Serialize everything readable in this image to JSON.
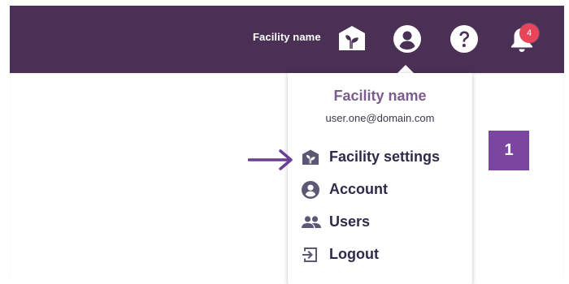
{
  "header": {
    "facility_name": "Facility name",
    "icons": [
      "facility-home-icon",
      "user-account-icon",
      "help-icon",
      "notifications-bell-icon"
    ],
    "notification_count": "4"
  },
  "dropdown": {
    "facility_name": "Facility name",
    "email": "user.one@domain.com",
    "items": [
      {
        "label": "Facility settings",
        "icon": "facility-settings-icon"
      },
      {
        "label": "Account",
        "icon": "account-icon"
      },
      {
        "label": "Users",
        "icon": "users-icon"
      },
      {
        "label": "Logout",
        "icon": "logout-icon"
      }
    ]
  },
  "annotation": {
    "step_number": "1"
  },
  "colors": {
    "topbar": "#4a3054",
    "accent_purple": "#7a46a0",
    "badge_red": "#e8445a",
    "menu_text": "#2e2a4a",
    "icon_gray": "#5b5876"
  }
}
